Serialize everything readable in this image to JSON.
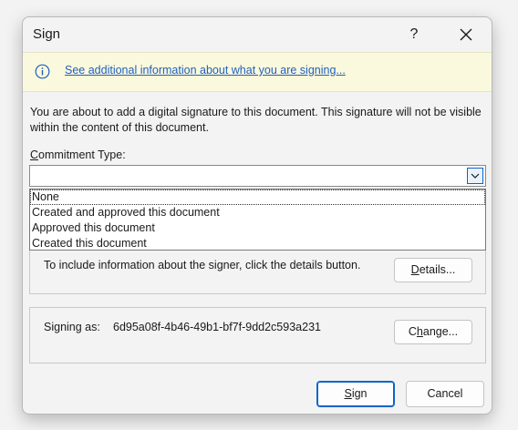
{
  "window": {
    "title": "Sign",
    "help_label": "?"
  },
  "infobar": {
    "link_text": "See additional information about what you are signing..."
  },
  "description": "You are about to add a digital signature to this document. This signature will not be visible within the content of this document.",
  "commitment": {
    "label_mnemonic": "C",
    "label_rest": "ommitment Type:",
    "value": "",
    "options": [
      "None",
      "Created and approved this document",
      "Approved this document",
      "Created this document"
    ]
  },
  "signer": {
    "details_text": "To include information about the signer, click the details button.",
    "details_button_mnemonic": "D",
    "details_button_rest": "etails..."
  },
  "signing": {
    "label": "Signing as:",
    "value": "6d95a08f-4b46-49b1-bf7f-9dd2c593a231",
    "change_button_pre": "C",
    "change_button_mnemonic": "h",
    "change_button_rest": "ange..."
  },
  "footer": {
    "sign_button_mnemonic": "S",
    "sign_button_rest": "ign",
    "cancel_button": "Cancel"
  },
  "colors": {
    "accent": "#0a64c8",
    "link": "#1f5fbf",
    "infobar_bg": "#fbf9dd"
  },
  "icons": [
    "info-icon",
    "close-icon",
    "chevron-down-icon"
  ]
}
